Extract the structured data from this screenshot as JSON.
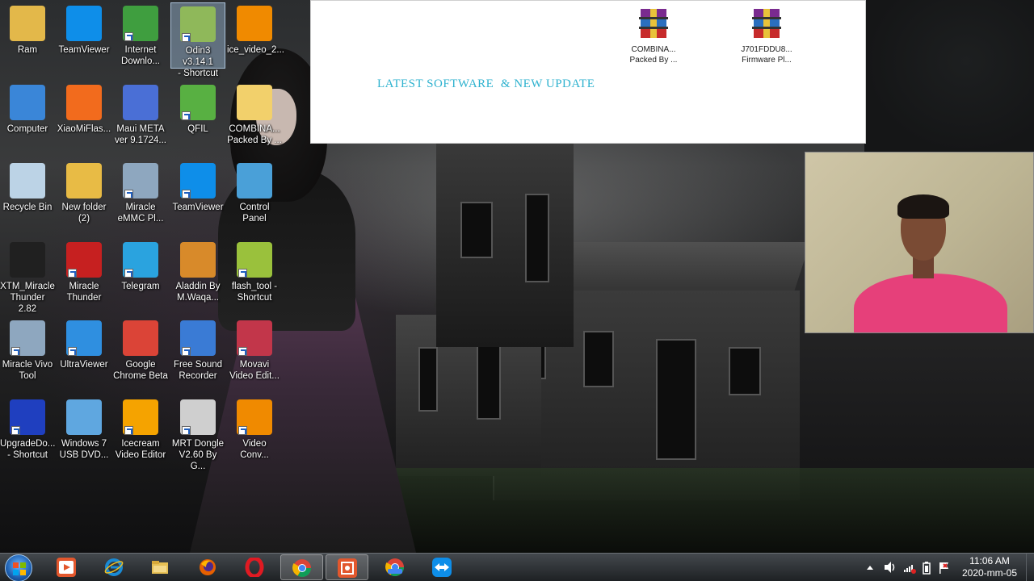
{
  "banner": {
    "title": "LATEST SOFTWARE  & NEW UPDATE",
    "files": [
      {
        "label_line1": "COMBINA...",
        "label_line2": "Packed By ..."
      },
      {
        "label_line1": "J701FDDU8...",
        "label_line2": "Firmware Pl..."
      }
    ]
  },
  "desktop_icons": [
    {
      "line1": "Ram",
      "line2": "",
      "icon": "user-folder-icon",
      "color": "#e3b84a"
    },
    {
      "line1": "TeamViewer",
      "line2": "",
      "icon": "teamviewer-icon",
      "color": "#0e8ee9"
    },
    {
      "line1": "Internet",
      "line2": "Downlo...",
      "icon": "internet-download-manager-icon",
      "color": "#3f9e3f"
    },
    {
      "line1": "Odin3 v3.14.1",
      "line2": "- Shortcut",
      "icon": "odin-icon",
      "color": "#8fb85a"
    },
    {
      "line1": "ice_video_2...",
      "line2": "",
      "icon": "vlc-icon",
      "color": "#f08a00"
    },
    {
      "line1": "Computer",
      "line2": "",
      "icon": "computer-icon",
      "color": "#3a86d8"
    },
    {
      "line1": "XiaoMiFlas...",
      "line2": "",
      "icon": "xiaomi-flash-icon",
      "color": "#f26b1d"
    },
    {
      "line1": "Maui META",
      "line2": "ver 9.1724...",
      "icon": "maui-meta-icon",
      "color": "#4a6fd6"
    },
    {
      "line1": "QFIL",
      "line2": "",
      "icon": "qfil-icon",
      "color": "#58b042"
    },
    {
      "line1": "COMBINA...",
      "line2": "Packed By ...",
      "icon": "folder-icon",
      "color": "#f2d06b"
    },
    {
      "line1": "Recycle Bin",
      "line2": "",
      "icon": "recycle-bin-icon",
      "color": "#bcd3e6"
    },
    {
      "line1": "New folder",
      "line2": "(2)",
      "icon": "folder-icon",
      "color": "#e8bb45"
    },
    {
      "line1": "Miracle",
      "line2": "eMMC Pl...",
      "icon": "miracle-emmc-icon",
      "color": "#8ea7bf"
    },
    {
      "line1": "TeamViewer",
      "line2": "",
      "icon": "teamviewer-icon",
      "color": "#0e8ee9"
    },
    {
      "line1": "Control",
      "line2": "Panel",
      "icon": "control-panel-icon",
      "color": "#4aa0d8"
    },
    {
      "line1": "XTM_Miracle",
      "line2": "Thunder 2.82",
      "icon": "gsm-team-icon",
      "color": "#202020"
    },
    {
      "line1": "Miracle",
      "line2": "Thunder",
      "icon": "miracle-thunder-icon",
      "color": "#c62020"
    },
    {
      "line1": "Telegram",
      "line2": "",
      "icon": "telegram-icon",
      "color": "#2aa3df"
    },
    {
      "line1": "Aladdin By",
      "line2": "M.Waqa...",
      "icon": "aladdin-icon",
      "color": "#d88a2a"
    },
    {
      "line1": "flash_tool -",
      "line2": "Shortcut",
      "icon": "android-flash-tool-icon",
      "color": "#9ac13c"
    },
    {
      "line1": "Miracle Vivo",
      "line2": "Tool",
      "icon": "miracle-vivo-icon",
      "color": "#8ea7bf"
    },
    {
      "line1": "UltraViewer",
      "line2": "",
      "icon": "ultraviewer-icon",
      "color": "#2f8fe0"
    },
    {
      "line1": "Google",
      "line2": "Chrome Beta",
      "icon": "chrome-beta-icon",
      "color": "#db4437"
    },
    {
      "line1": "Free Sound",
      "line2": "Recorder",
      "icon": "sound-recorder-icon",
      "color": "#3a7bd5"
    },
    {
      "line1": "Movavi",
      "line2": "Video Edit...",
      "icon": "movavi-icon",
      "color": "#c2364a"
    },
    {
      "line1": "UpgradeDo...",
      "line2": "- Shortcut",
      "icon": "upgrade-download-icon",
      "color": "#1f3fbf"
    },
    {
      "line1": "Windows 7",
      "line2": "USB DVD...",
      "icon": "windows-usb-dvd-icon",
      "color": "#5fa7e0"
    },
    {
      "line1": "Icecream",
      "line2": "Video Editor",
      "icon": "icecream-editor-icon",
      "color": "#f5a300"
    },
    {
      "line1": "MRT Dongle",
      "line2": "V2.60 By G...",
      "icon": "mrt-dongle-icon",
      "color": "#cfcfcf"
    },
    {
      "line1": "Video",
      "line2": "Conv...",
      "icon": "video-converter-icon",
      "color": "#f08a00"
    }
  ],
  "taskbar": {
    "apps": [
      {
        "name": "start-button",
        "icon": "windows-logo-icon"
      },
      {
        "name": "media-player",
        "icon": "media-player-icon",
        "color": "#e2572d"
      },
      {
        "name": "internet-explorer",
        "icon": "internet-explorer-icon",
        "color": "#1a8ad4"
      },
      {
        "name": "file-explorer",
        "icon": "file-explorer-icon",
        "color": "#e7c055"
      },
      {
        "name": "firefox",
        "icon": "firefox-icon",
        "color": "#e66000"
      },
      {
        "name": "opera",
        "icon": "opera-icon",
        "color": "#e01a22"
      },
      {
        "name": "chrome",
        "icon": "chrome-icon",
        "color": "#4285f4"
      },
      {
        "name": "screen-recorder",
        "icon": "screen-recorder-icon",
        "color": "#e2572d"
      },
      {
        "name": "chrome-beta",
        "icon": "chrome-beta-icon",
        "color": "#db4437"
      },
      {
        "name": "teamviewer",
        "icon": "teamviewer-icon",
        "color": "#0e8ee9"
      }
    ],
    "clock": {
      "time": "11:06 AM",
      "date": "2020-mm-05"
    }
  }
}
